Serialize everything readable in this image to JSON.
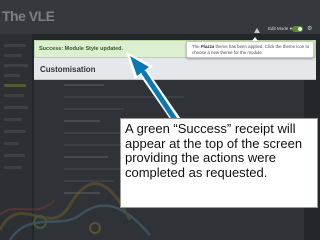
{
  "app": {
    "logo_text": "The VLE"
  },
  "toolbar": {
    "home_icon": "home-icon",
    "edit_mode_label": "Edit Mode ●",
    "gear_icon": "gear-icon",
    "gear_glyph": "⚙"
  },
  "notice": {
    "success_text": "Success: Module Style updated.",
    "color": "#dcefd0"
  },
  "panel": {
    "title": "Customisation"
  },
  "popover": {
    "text_before": "The ",
    "theme_name": "Piazza",
    "text_after": " theme has been applied. Click the theme icon to choose a new theme for the module."
  },
  "callout": {
    "text": "A green “Success” receipt will appear at the top of the screen providing the actions were completed as requested.",
    "arrow_color": "#0b78b6"
  }
}
